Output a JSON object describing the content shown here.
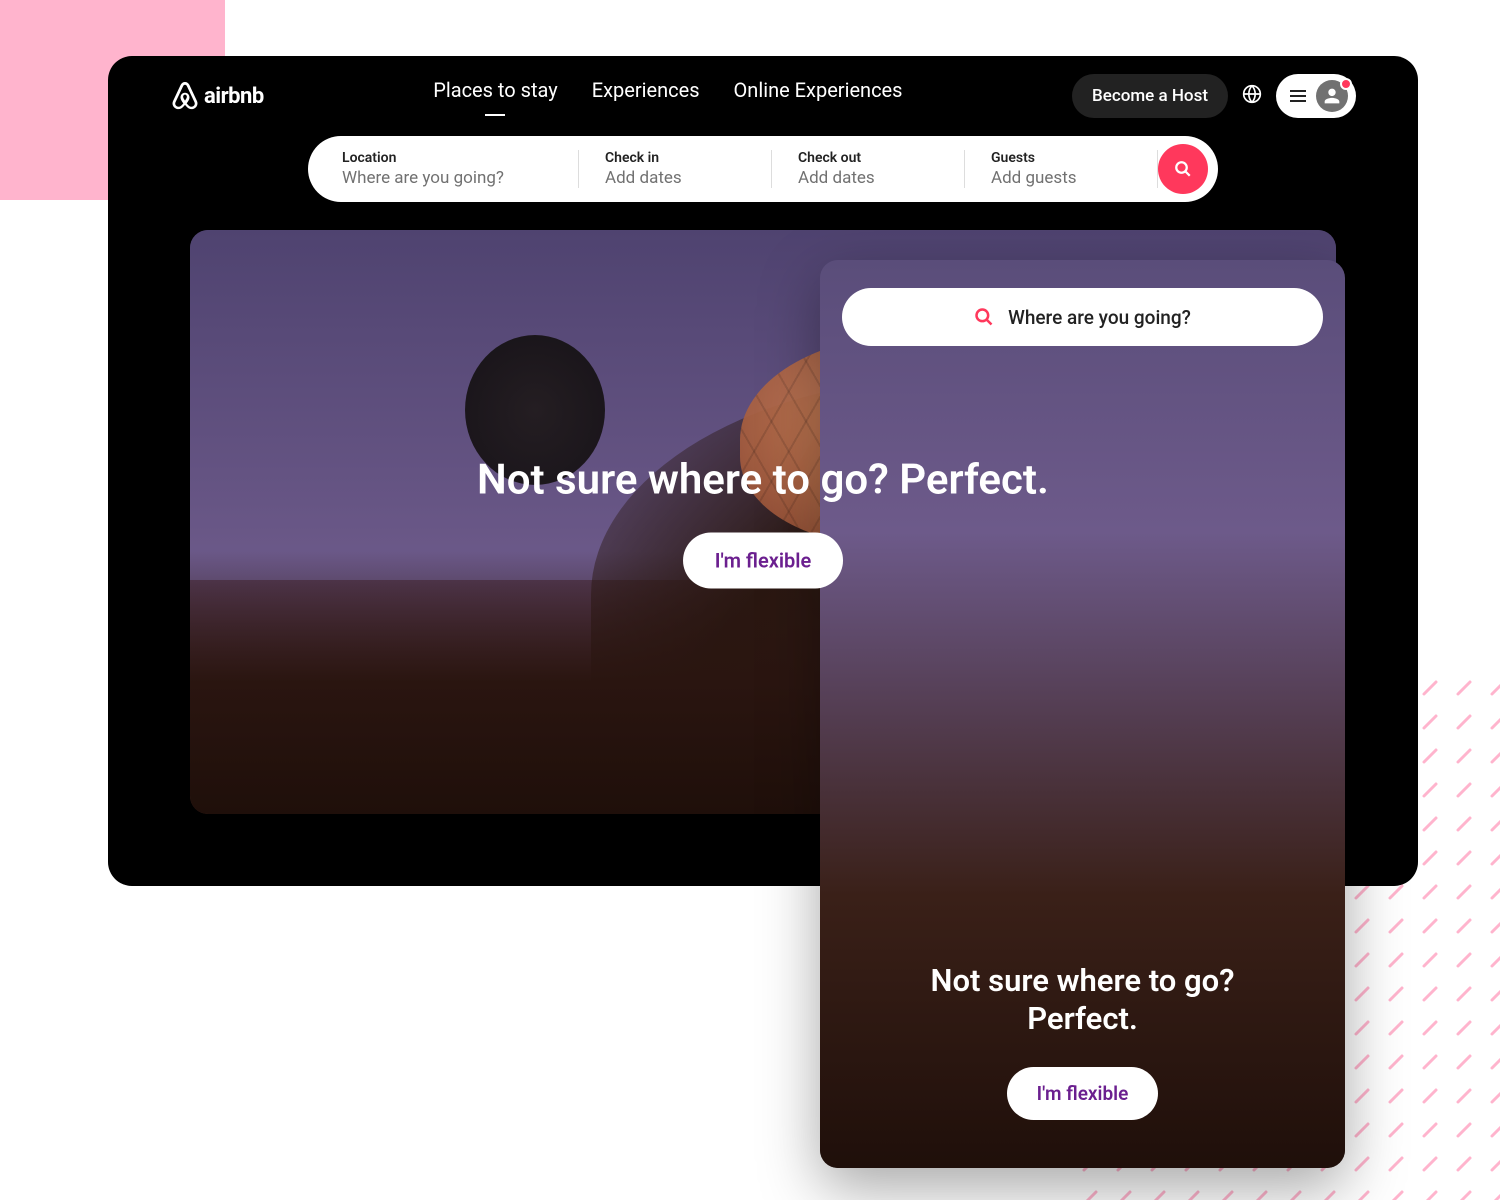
{
  "brand": {
    "name": "airbnb"
  },
  "nav": {
    "tabs": [
      {
        "label": "Places to stay",
        "active": true
      },
      {
        "label": "Experiences"
      },
      {
        "label": "Online Experiences"
      }
    ],
    "host_label": "Become a Host"
  },
  "search": {
    "cells": [
      {
        "label": "Location",
        "placeholder": "Where are you going?"
      },
      {
        "label": "Check in",
        "placeholder": "Add dates"
      },
      {
        "label": "Check out",
        "placeholder": "Add dates"
      },
      {
        "label": "Guests",
        "placeholder": "Add guests"
      }
    ]
  },
  "hero": {
    "title": "Not sure where to go? Perfect.",
    "cta": "I'm flexible"
  },
  "mobile": {
    "search_placeholder": "Where are you going?",
    "title_line1": "Not sure where to go?",
    "title_line2": "Perfect.",
    "cta": "I'm flexible"
  },
  "colors": {
    "accent": "#ff385c",
    "cta_text": "#6b1f8f",
    "decor_pink": "#ffb4cd"
  }
}
